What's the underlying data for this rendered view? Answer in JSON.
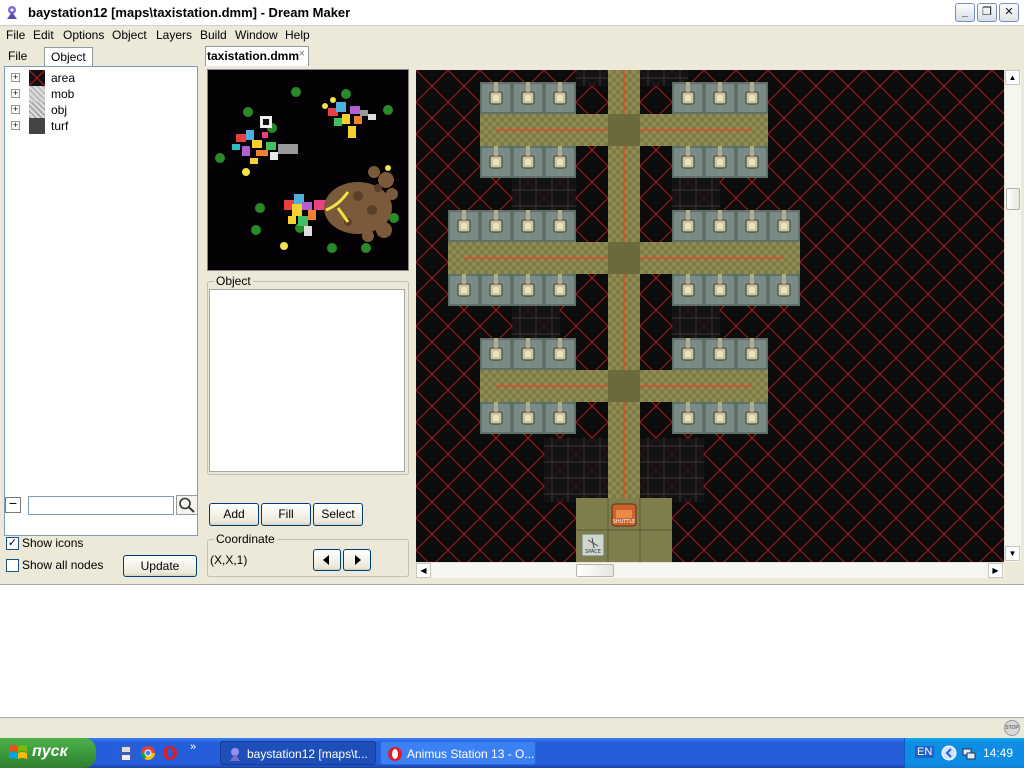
{
  "window": {
    "title": "baystation12 [maps\\taxistation.dmm] - Dream Maker"
  },
  "menu": [
    "File",
    "Edit",
    "Options",
    "Object",
    "Layers",
    "Build",
    "Window",
    "Help"
  ],
  "left_panel": {
    "tabs": [
      "File",
      "Object"
    ],
    "tree_items": [
      "area",
      "mob",
      "obj",
      "turf"
    ],
    "search_placeholder": "",
    "show_icons_label": "Show icons",
    "show_icons_checked": true,
    "show_all_nodes_label": "Show all nodes",
    "show_all_nodes_checked": false,
    "update_label": "Update"
  },
  "document_tab": {
    "label": "taxistation.dmm",
    "close": "×"
  },
  "middle_panel": {
    "object_group": "Object",
    "add_label": "Add",
    "fill_label": "Fill",
    "select_label": "Select",
    "coordinate_group": "Coordinate",
    "coordinate_value": "(X,X,1)"
  },
  "map": {
    "space_label": "SPACE",
    "door_label": "SHUTTLE"
  },
  "taskbar": {
    "start_label": "пуск",
    "tasks": [
      "baystation12 [maps\\t...",
      "Animus Station 13 - O..."
    ],
    "language": "EN",
    "clock": "14:49"
  },
  "colors": {
    "xp_blue": "#245edb",
    "start_green": "#3c9a3b",
    "map_grid_red": "#c41a1a",
    "map_background": "#0c0c0c"
  }
}
